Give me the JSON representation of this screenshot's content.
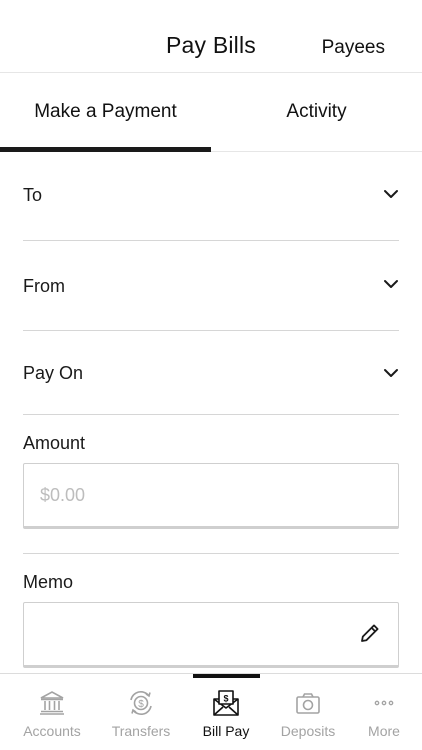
{
  "header": {
    "title": "Pay Bills",
    "payees_label": "Payees"
  },
  "tabs": [
    {
      "label": "Make a Payment",
      "active": true
    },
    {
      "label": "Activity",
      "active": false
    }
  ],
  "form": {
    "to_label": "To",
    "from_label": "From",
    "pay_on_label": "Pay On",
    "amount_label": "Amount",
    "amount_placeholder": "$0.00",
    "amount_value": "",
    "memo_label": "Memo",
    "memo_value": ""
  },
  "bottom_nav": {
    "items": [
      {
        "label": "Accounts",
        "icon": "bank-icon",
        "active": false
      },
      {
        "label": "Transfers",
        "icon": "transfer-icon",
        "active": false
      },
      {
        "label": "Bill Pay",
        "icon": "bill-envelope-icon",
        "active": true
      },
      {
        "label": "Deposits",
        "icon": "camera-icon",
        "active": false
      },
      {
        "label": "More",
        "icon": "more-dots-icon",
        "active": false
      }
    ]
  },
  "colors": {
    "text": "#1a1a1a",
    "muted": "#a3a3a3",
    "divider": "#d6d6d6",
    "active_indicator": "#111111"
  }
}
